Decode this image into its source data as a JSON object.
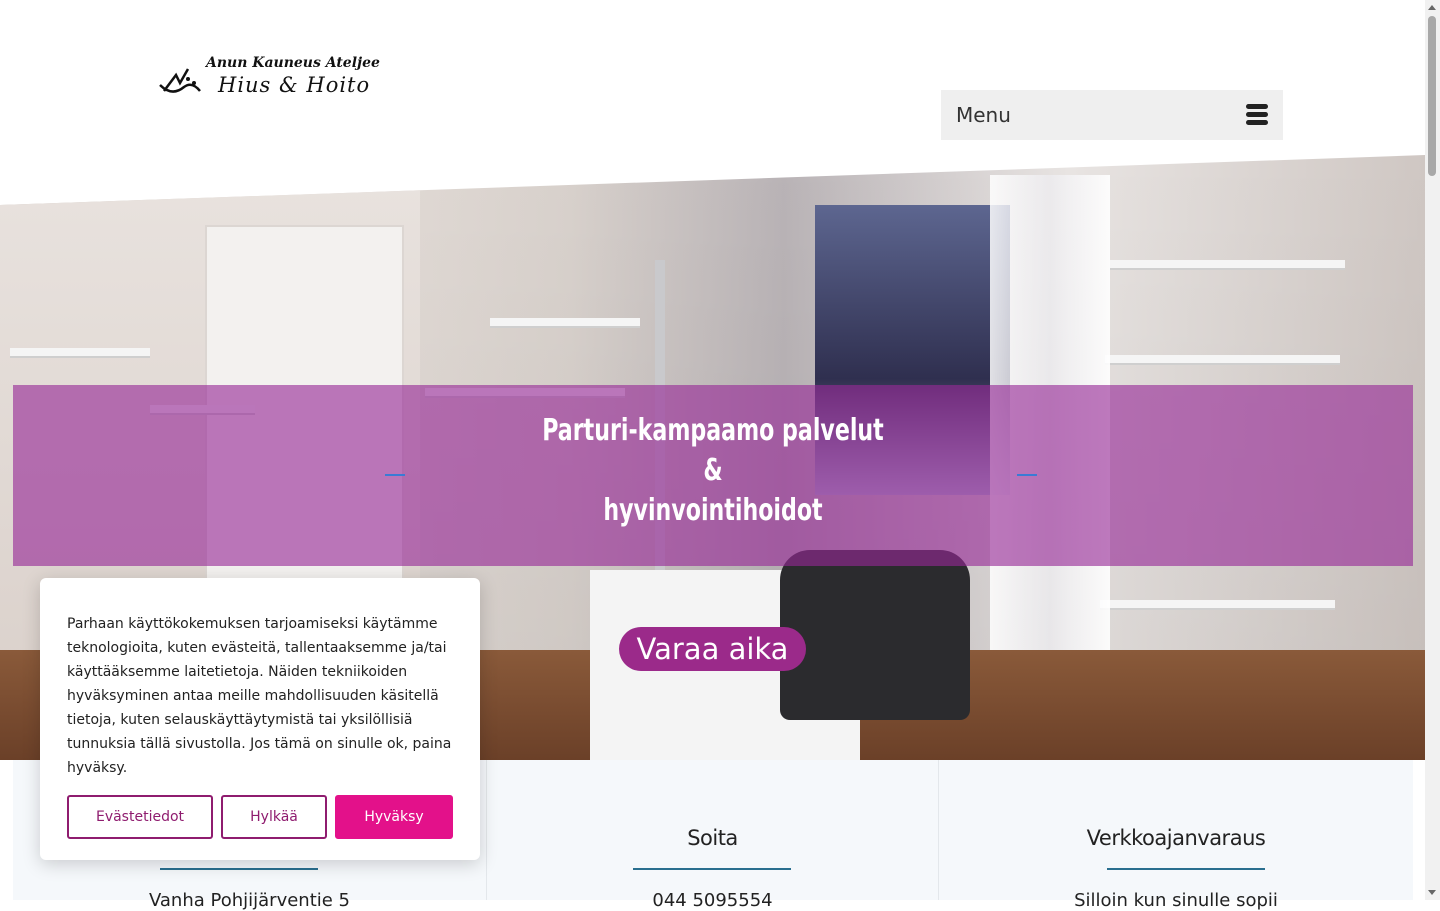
{
  "header": {
    "logo_line1": "Anun Kauneus Ateljee",
    "logo_line2": "Hius & Hoito",
    "menu_label": "Menu"
  },
  "hero": {
    "title_line1": "Parturi-kampaamo palvelut",
    "title_line2": "&",
    "title_line3": "hyvinvointihoidot",
    "cta_label": "Varaa aika"
  },
  "info": {
    "columns": [
      {
        "title": "",
        "text": "Vanha Pohjijärventie 5"
      },
      {
        "title": "Soita",
        "text": "044 5095554"
      },
      {
        "title": "Verkkoajanvaraus",
        "text": "Silloin kun sinulle sopii"
      }
    ]
  },
  "cookie": {
    "message": "Parhaan käyttökokemuksen tarjoamiseksi käytämme teknologioita, kuten evästeitä, tallentaaksemme ja/tai käyttääksemme laitetietoja. Näiden tekniikoiden hyväksyminen antaa meille mahdollisuuden käsitellä tietoja, kuten selauskäyttäytymistä tai yksilöllisiä tunnuksia tällä sivustolla. Jos tämä on sinulle ok, paina hyväksy.",
    "details_label": "Evästetiedot",
    "reject_label": "Hylkää",
    "accept_label": "Hyväksy"
  },
  "colors": {
    "accent": "#e3118a",
    "banner": "#962896",
    "cta": "#9b2a8a",
    "rule": "#2a6f8f"
  }
}
